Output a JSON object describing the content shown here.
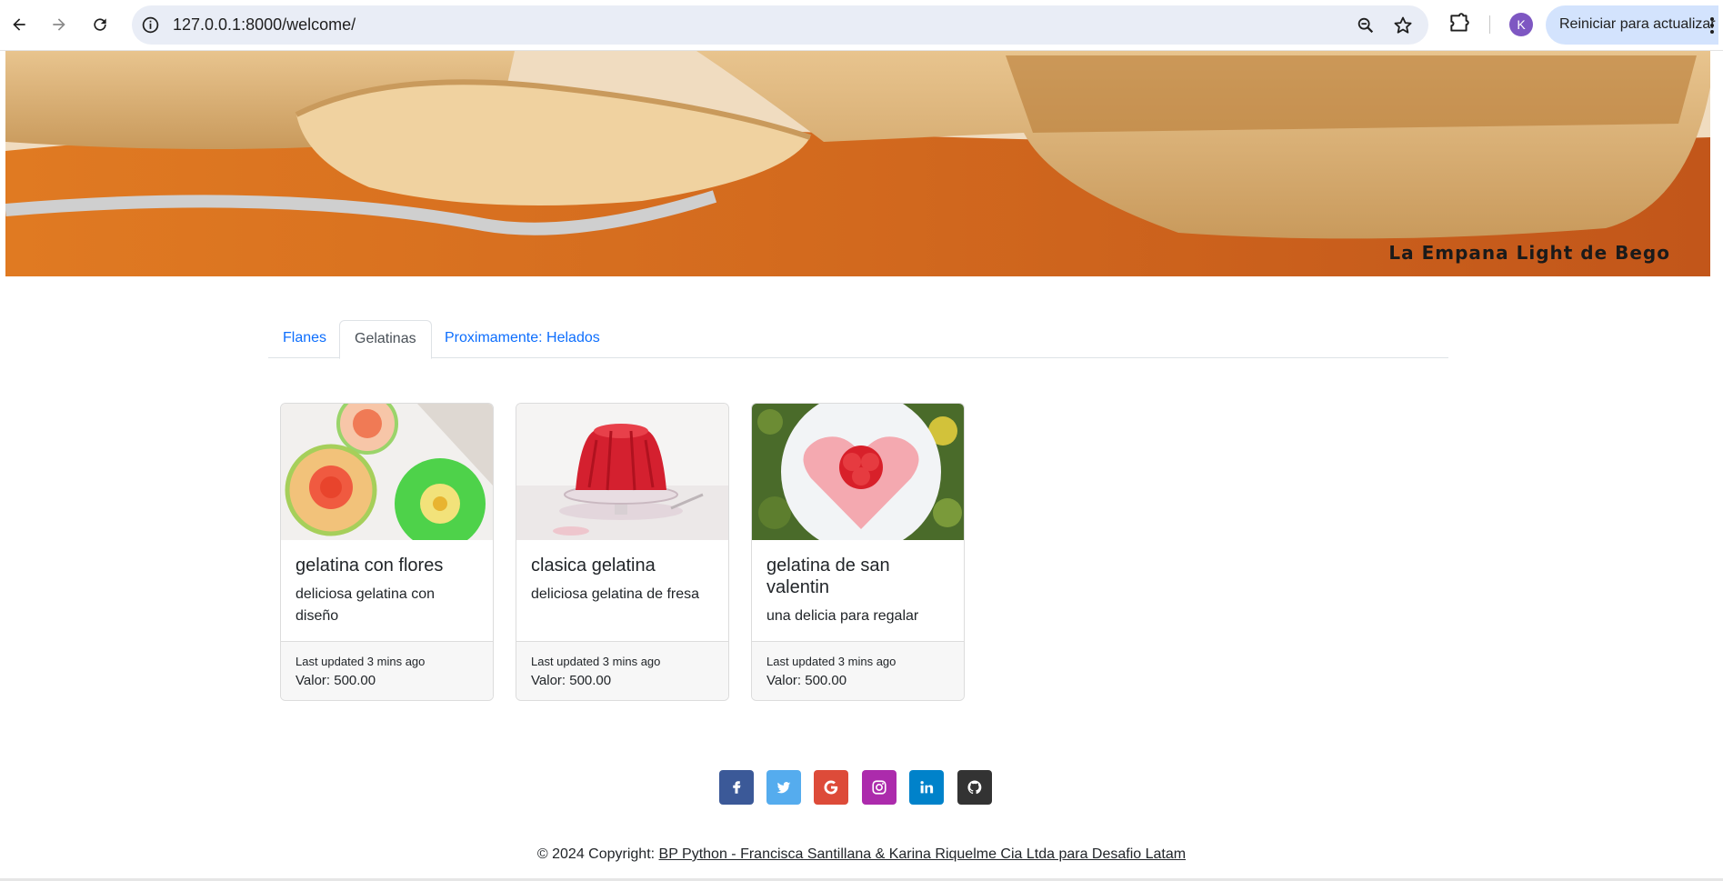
{
  "browser": {
    "url": "127.0.0.1:8000/welcome/",
    "profile_initial": "K",
    "restart_label": "Reiniciar para actualizar"
  },
  "banner": {
    "caption": "La Empana Light de Bego"
  },
  "tabs": [
    {
      "label": "Flanes",
      "active": false
    },
    {
      "label": "Gelatinas",
      "active": true
    },
    {
      "label": "Proximamente: Helados",
      "active": false
    }
  ],
  "cards": [
    {
      "title": "gelatina con flores",
      "text": "deliciosa gelatina con diseño",
      "updated": "Last updated 3 mins ago",
      "price": "Valor: 500.00"
    },
    {
      "title": "clasica gelatina",
      "text": "deliciosa gelatina de fresa",
      "updated": "Last updated 3 mins ago",
      "price": "Valor: 500.00"
    },
    {
      "title": "gelatina de san valentin",
      "text": "una delicia para regalar",
      "updated": "Last updated 3 mins ago",
      "price": "Valor: 500.00"
    }
  ],
  "social": [
    {
      "name": "facebook",
      "color": "#3b5998"
    },
    {
      "name": "twitter",
      "color": "#55acee"
    },
    {
      "name": "google",
      "color": "#dd4b39"
    },
    {
      "name": "instagram",
      "color": "#ac2bac"
    },
    {
      "name": "linkedin",
      "color": "#0082ca"
    },
    {
      "name": "github",
      "color": "#333333"
    }
  ],
  "footer": {
    "prefix": "© 2024 Copyright: ",
    "link": "BP Python - Francisca Santillana & Karina Riquelme Cia Ltda para Desafio Latam"
  }
}
